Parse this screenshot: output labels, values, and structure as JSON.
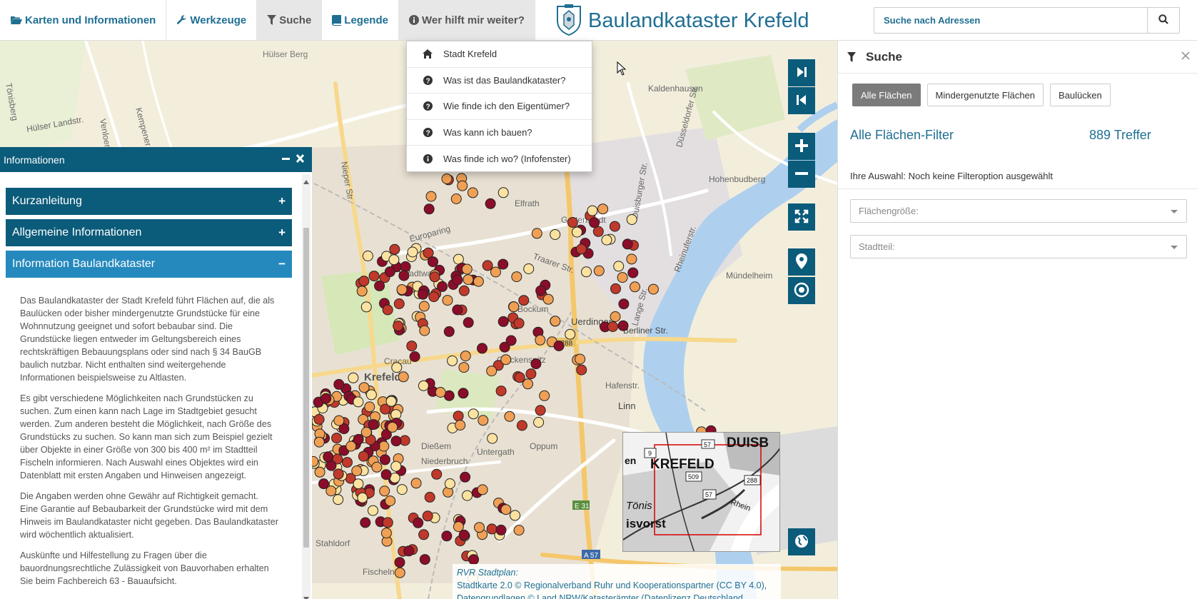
{
  "nav": {
    "items": [
      {
        "label": "Karten und Informationen",
        "icon": "folder-open-icon"
      },
      {
        "label": "Werkzeuge",
        "icon": "wrench-icon"
      },
      {
        "label": "Suche",
        "icon": "filter-icon"
      },
      {
        "label": "Legende",
        "icon": "book-icon"
      },
      {
        "label": "Wer hilft mir weiter?",
        "icon": "info-circle-icon"
      }
    ],
    "brand_title": "Baulandkataster Krefeld",
    "address_placeholder": "Suche nach Adressen"
  },
  "help_menu": {
    "items": [
      {
        "label": "Stadt Krefeld",
        "icon": "home-icon"
      },
      {
        "label": "Was ist das Baulandkataster?",
        "icon": "question-circle-icon"
      },
      {
        "label": "Wie finde ich den Eigentümer?",
        "icon": "question-circle-icon"
      },
      {
        "label": "Was kann ich bauen?",
        "icon": "question-circle-icon"
      },
      {
        "label": "Was finde ich wo? (Infofenster)",
        "icon": "info-circle-icon"
      }
    ]
  },
  "map": {
    "place_labels": [
      "Hülser Berg",
      "Kaldenhausen",
      "Hohenbudberg",
      "Elfrath",
      "Gartenstadt",
      "Stadtwald",
      "Bockum",
      "Uerdingen",
      "Berliner Str.",
      "Cracau",
      "Krefeld",
      "Glockenspitz",
      "Hafenstr.",
      "Linn",
      "Dießem",
      "Oppum",
      "Niederbruch",
      "Untergath",
      "Stahldorf",
      "Fischeln",
      "Mündelheim",
      "Europaring",
      "Traarer Str.",
      "Dießem"
    ],
    "road_labels": [
      "Tönisberg",
      "Hülser Landstr.",
      "Kempener Str.",
      "Venloer Str.",
      "Nieper Str.",
      "Düsseldorfer Str.",
      "Duisburger Str.",
      "Rheinuferstr.",
      "Lange Str.",
      "B 288",
      "E 31",
      "A 57"
    ],
    "overview": {
      "labels": [
        "KREFELD",
        "DUISB",
        "Tönis",
        "isvorst",
        "Rhein",
        "en",
        "509",
        "57",
        "288",
        "9",
        "57"
      ]
    },
    "attribution": {
      "source": "RVR Stadtplan:",
      "text": "Stadtkarte 2.0 © Regionalverband Ruhr und Kooperationspartner (CC BY 4.0), Datengrundlagen © Land NRW/Katasterämter (Datenlizenz Deutschland"
    },
    "controls": [
      "next-extent-icon",
      "previous-extent-icon",
      "zoom-in-icon",
      "zoom-out-icon",
      "fullscreen-icon",
      "location-marker-icon",
      "locate-me-icon",
      "globe-icon"
    ]
  },
  "info_panel": {
    "title": "Informationen",
    "accordion": [
      {
        "label": "Kurzanleitung",
        "sign": "+"
      },
      {
        "label": "Allgemeine Informationen",
        "sign": "+"
      },
      {
        "label": "Information Baulandkataster",
        "sign": "−"
      }
    ],
    "paragraphs": [
      "Das Baulandkataster der Stadt Krefeld führt Flächen auf, die als Baulücken oder bisher mindergenutzte Grundstücke für eine Wohnnutzung geeignet und sofort bebaubar sind. Die Grundstücke liegen entweder im Geltungsbereich eines rechtskräftigen Bebauungsplans oder sind nach § 34 BauGB baulich nutzbar. Nicht enthalten sind weitergehende Informationen beispielsweise zu Altlasten.",
      "Es gibt verschiedene Möglichkeiten nach Grundstücken zu suchen. Zum einen kann nach Lage im Stadtgebiet gesucht werden. Zum anderen besteht die Möglichkeit, nach Größe des Grundstücks zu suchen. So kann man sich zum Beispiel gezielt über Objekte in einer Größe von 300 bis 400 m² im Stadtteil Fischeln informieren. Nach Auswahl eines Objektes wird ein Datenblatt mit ersten Angaben und Hinweisen angezeigt.",
      "Die Angaben werden ohne Gewähr auf Richtigkeit gemacht. Eine Garantie auf Bebaubarkeit der Grundstücke wird mit dem Hinweis im Baulandkataster nicht gegeben. Das Baulandkataster wird wöchentlich aktualisiert.",
      "Auskünfte und Hilfestellung zu Fragen über die bauordnungsrechtliche Zulässigkeit von Bauvorhaben erhalten Sie beim Fachbereich 63 - Bauaufsicht."
    ]
  },
  "search_panel": {
    "title": "Suche",
    "tabs": [
      {
        "label": "Alle Flächen",
        "active": true
      },
      {
        "label": "Mindergenutzte Flächen",
        "active": false
      },
      {
        "label": "Baulücken",
        "active": false
      }
    ],
    "filter_title": "Alle Flächen-Filter",
    "result_count": "889 Treffer",
    "selection_text": "Ihre Auswahl: Noch keine Filteroption ausgewählt",
    "selects": [
      {
        "placeholder": "Flächengröße:"
      },
      {
        "placeholder": "Stadtteil:"
      }
    ]
  },
  "colors": {
    "primary": "#0b5b7a",
    "accent": "#2589bd",
    "link": "#1f6f93",
    "marker_dark": "#8b0d2a",
    "marker_red": "#c0392b",
    "marker_orange": "#f0a055",
    "marker_light": "#fbe2a0"
  }
}
